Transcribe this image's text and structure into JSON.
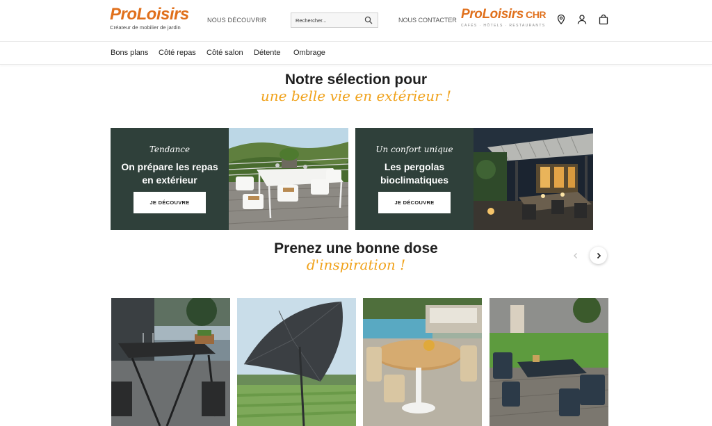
{
  "header": {
    "logo": "ProLoisirs",
    "logo_tagline": "Créateur de mobilier de jardin",
    "discover": "NOUS DÉCOUVRIR",
    "search_placeholder": "Rechercher...",
    "contact": "NOUS CONTACTER",
    "chr_logo": "ProLoisirs",
    "chr_suffix": "CHR",
    "chr_tagline": "CAFÉS · HÔTELS · RESTAURANTS",
    "icons": [
      "location-pin-icon",
      "user-icon",
      "shopping-bag-icon"
    ]
  },
  "nav": [
    "Bons plans",
    "Côté repas",
    "Côté salon",
    "Détente",
    "Ombrage"
  ],
  "selection": {
    "title": "Notre sélection pour",
    "subtitle": "une belle vie en extérieur !"
  },
  "promos": [
    {
      "kicker": "Tendance",
      "heading_1": "On prépare les repas",
      "heading_2": "en extérieur",
      "button": "JE DÉCOUVRE"
    },
    {
      "kicker": "Un confort unique",
      "heading_1": "Les pergolas",
      "heading_2": "bioclimatiques",
      "button": "JE DÉCOUVRE"
    }
  ],
  "inspiration": {
    "title": "Prenez une bonne dose",
    "subtitle": "d'inspiration !"
  },
  "colors": {
    "brand_orange": "#e0701c",
    "brand_red": "#c0392b",
    "accent_yellow": "#f0a21b",
    "promo_green": "#2f403a"
  }
}
